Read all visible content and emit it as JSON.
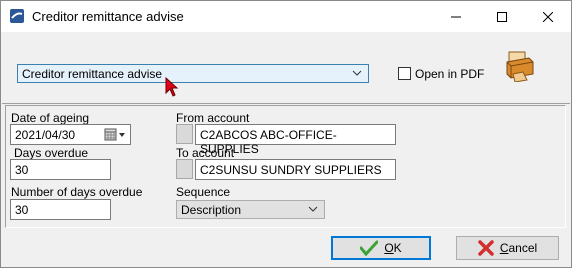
{
  "window": {
    "title": "Creditor remittance advise"
  },
  "top": {
    "report_selected": "Creditor remittance advise",
    "open_pdf_label": "Open in PDF"
  },
  "form": {
    "date_label": "Date of ageing",
    "date_value": "2021/04/30",
    "days_label": "Days overdue",
    "days_value": "30",
    "num_days_label": "Number of days overdue",
    "num_days_value": "30",
    "from_label": "From account",
    "from_value": "C2ABCOS ABC-OFFICE-SUPPLIES",
    "to_label": "To account",
    "to_value": "C2SUNSU SUNDRY SUPPLIERS",
    "seq_label": "Sequence",
    "seq_value": "Description"
  },
  "buttons": {
    "ok_first": "O",
    "ok_rest": "K",
    "cancel_first": "C",
    "cancel_rest": "ancel"
  }
}
